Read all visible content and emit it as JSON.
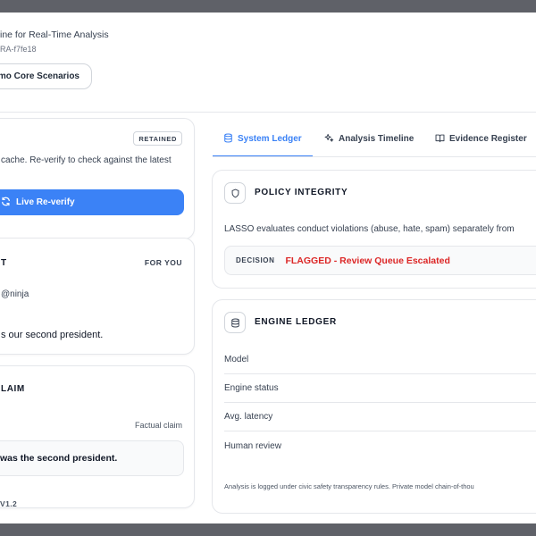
{
  "header": {
    "title": "ine for Real-Time Analysis",
    "id": "RA-f7fe18",
    "demo_button": "mo Core Scenarios"
  },
  "retained_card": {
    "badge": "RETAINED",
    "text": "cache. Re-verify to check against the latest",
    "reverify_button": "Live Re-verify"
  },
  "post_card": {
    "title": "T",
    "feed_label": "FOR YOU",
    "handle": "@ninja",
    "text": "s our second president."
  },
  "claim_card": {
    "title": "LAIM",
    "type": "Factual claim",
    "claim": "was the second president."
  },
  "version": "V1.2",
  "tabs": [
    {
      "label": "System Ledger",
      "icon": "database-icon",
      "active": true
    },
    {
      "label": "Analysis Timeline",
      "icon": "sparkle-icon",
      "active": false
    },
    {
      "label": "Evidence Register",
      "icon": "book-icon",
      "active": false
    }
  ],
  "policy": {
    "title": "POLICY INTEGRITY",
    "text": "LASSO evaluates conduct violations (abuse, hate, spam) separately from",
    "decision_label": "DECISION",
    "decision_value": "FLAGGED - Review Queue Escalated"
  },
  "engine": {
    "title": "ENGINE LEDGER",
    "rows": [
      "Model",
      "Engine status",
      "Avg. latency",
      "Human review"
    ],
    "footnote": "Analysis is logged under civic safety transparency rules. Private model chain-of-thou"
  },
  "colors": {
    "accent": "#3b82f6",
    "danger": "#dc2626",
    "border": "#e5e7eb"
  }
}
